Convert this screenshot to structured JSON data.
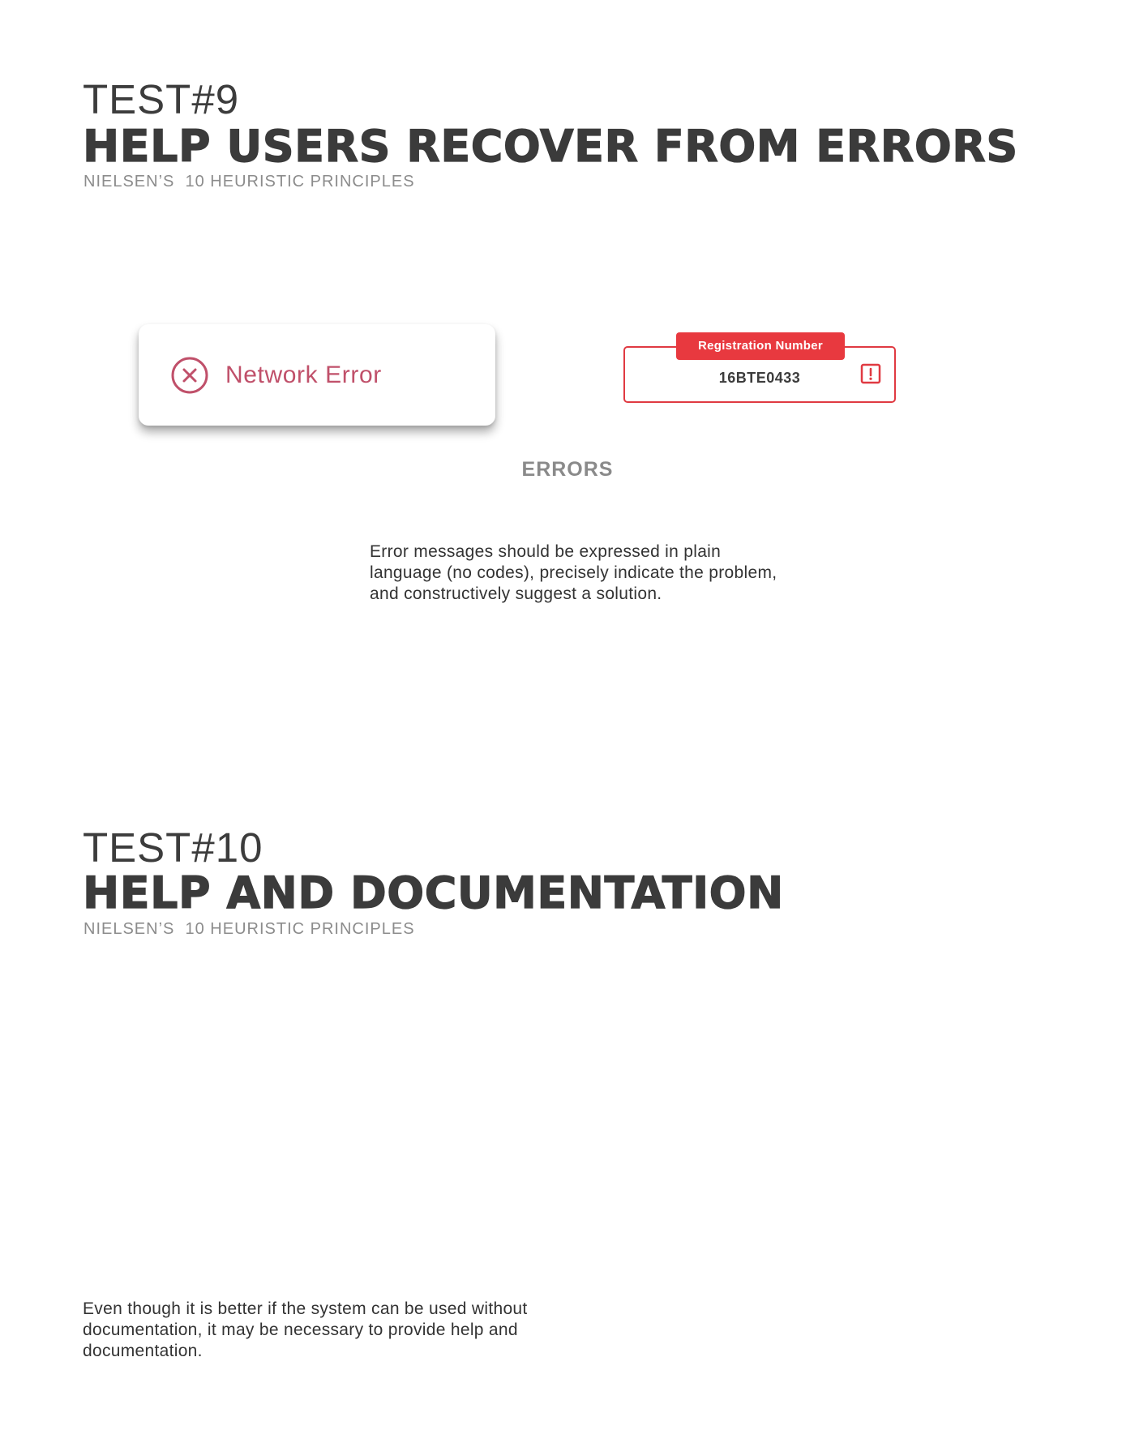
{
  "test9": {
    "number": "TEST#9",
    "title": "HELP USERS RECOVER FROM ERRORS",
    "subtitle": "NIELSEN’S  10 HEURISTIC PRINCIPLES",
    "toast": {
      "icon": "close-circle-icon",
      "text": "Network Error",
      "color": "#c0506a"
    },
    "registration_field": {
      "label": "Registration Number",
      "value": "16BTE0433",
      "icon": "alert-square-icon",
      "accent": "#e8393f"
    },
    "caption": "ERRORS",
    "description": "Error messages should be expressed in plain language (no codes), precisely indicate the problem, and constructively suggest a solution."
  },
  "test10": {
    "number": "TEST#10",
    "title": "HELP AND DOCUMENTATION",
    "subtitle": "NIELSEN’S  10 HEURISTIC PRINCIPLES",
    "description": "Even though it is better if the system can be used without documentation, it may be necessary to provide help and documentation."
  }
}
